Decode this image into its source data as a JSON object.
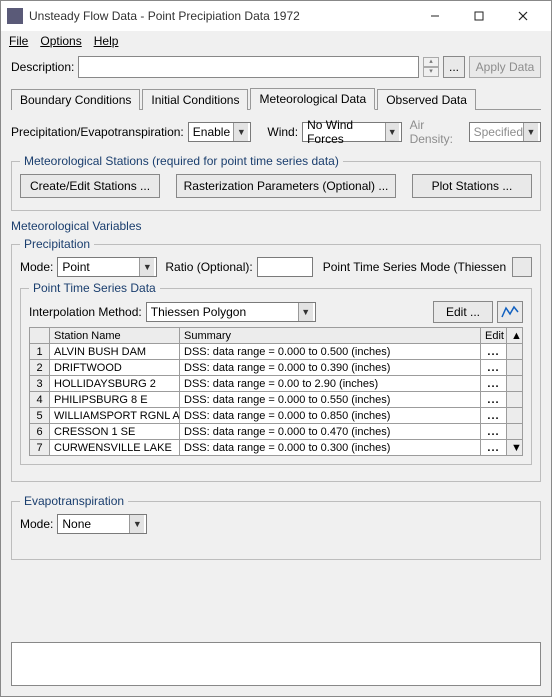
{
  "window": {
    "title": "Unsteady Flow Data - Point Precipiation Data 1972"
  },
  "menu": {
    "file": "File",
    "options": "Options",
    "help": "Help"
  },
  "desc": {
    "label": "Description:",
    "value": "",
    "btn": "...",
    "apply": "Apply Data"
  },
  "tabs": {
    "boundary": "Boundary Conditions",
    "initial": "Initial Conditions",
    "met": "Meteorological Data",
    "observed": "Observed Data"
  },
  "pe": {
    "label": "Precipitation/Evapotranspiration:",
    "value": "Enable",
    "wind_label": "Wind:",
    "wind_value": "No Wind Forces",
    "airdens_label": "Air Density:",
    "airdens_value": "Specified"
  },
  "stations": {
    "legend": "Meteorological Stations (required for point time series data)",
    "create": "Create/Edit Stations ...",
    "raster": "Rasterization Parameters (Optional) ...",
    "plot": "Plot Stations ..."
  },
  "vars_title": "Meteorological Variables",
  "precip": {
    "legend": "Precipitation",
    "mode_label": "Mode:",
    "mode_value": "Point",
    "ratio_label": "Ratio (Optional):",
    "ratio_value": "",
    "ptsm_label": "Point Time Series Mode (Thiessen",
    "pts_legend": "Point Time Series Data",
    "interp_label": "Interpolation Method:",
    "interp_value": "Thiessen Polygon",
    "edit_btn": "Edit ...",
    "cols": {
      "name": "Station Name",
      "summary": "Summary",
      "edit": "Edit"
    },
    "rows": [
      {
        "n": "1",
        "name": "ALVIN BUSH DAM",
        "summary": "DSS: data range = 0.000 to 0.500 (inches)"
      },
      {
        "n": "2",
        "name": "DRIFTWOOD",
        "summary": "DSS: data range = 0.000 to 0.390 (inches)"
      },
      {
        "n": "3",
        "name": "HOLLIDAYSBURG 2",
        "summary": "DSS: data range = 0.00 to 2.90 (inches)"
      },
      {
        "n": "4",
        "name": "PHILIPSBURG 8 E",
        "summary": "DSS: data range = 0.000 to 0.550 (inches)"
      },
      {
        "n": "5",
        "name": "WILLIAMSPORT RGNL AP",
        "summary": "DSS: data range = 0.000 to 0.850 (inches)"
      },
      {
        "n": "6",
        "name": "CRESSON 1 SE",
        "summary": "DSS: data range = 0.000 to 0.470 (inches)"
      },
      {
        "n": "7",
        "name": "CURWENSVILLE LAKE",
        "summary": "DSS: data range = 0.000 to 0.300 (inches)"
      }
    ],
    "ellipsis": "..."
  },
  "evap": {
    "legend": "Evapotranspiration",
    "mode_label": "Mode:",
    "mode_value": "None"
  }
}
